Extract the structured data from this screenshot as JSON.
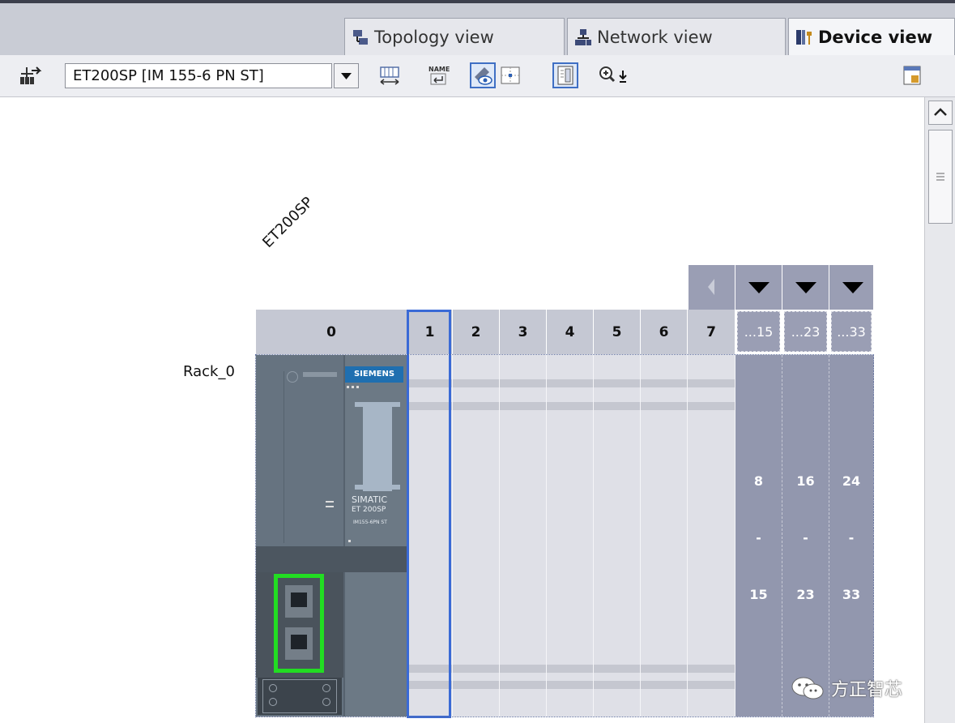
{
  "tabs": [
    {
      "label": "Topology view",
      "icon": "topology-icon"
    },
    {
      "label": "Network view",
      "icon": "network-icon"
    },
    {
      "label": "Device view",
      "icon": "device-icon"
    }
  ],
  "toolbar": {
    "device_select_value": "ET200SP [IM 155-6 PN ST]"
  },
  "canvas": {
    "device_name": "ET200SP",
    "rack_label": "Rack_0",
    "slot_headers": [
      "0",
      "1",
      "2",
      "3",
      "4",
      "5",
      "6",
      "7"
    ],
    "selected_slot": "1",
    "ext_headers": [
      "...15",
      "...23",
      "...33"
    ],
    "ext_ranges": [
      {
        "start": "8",
        "sep": "-",
        "end": "15"
      },
      {
        "start": "16",
        "sep": "-",
        "end": "23"
      },
      {
        "start": "24",
        "sep": "-",
        "end": "33"
      }
    ],
    "module": {
      "brand": "SIEMENS",
      "line1": "SIMATIC",
      "line2": "ET 200SP",
      "line3": "IM155-6PN ST"
    }
  },
  "watermark": "方正智芯",
  "colors": {
    "active_tab_border": "#3f6fc4",
    "port_highlight": "#22dd22",
    "selected_slot_border": "#3a6ad6",
    "rack_extension": "#9297ae"
  }
}
